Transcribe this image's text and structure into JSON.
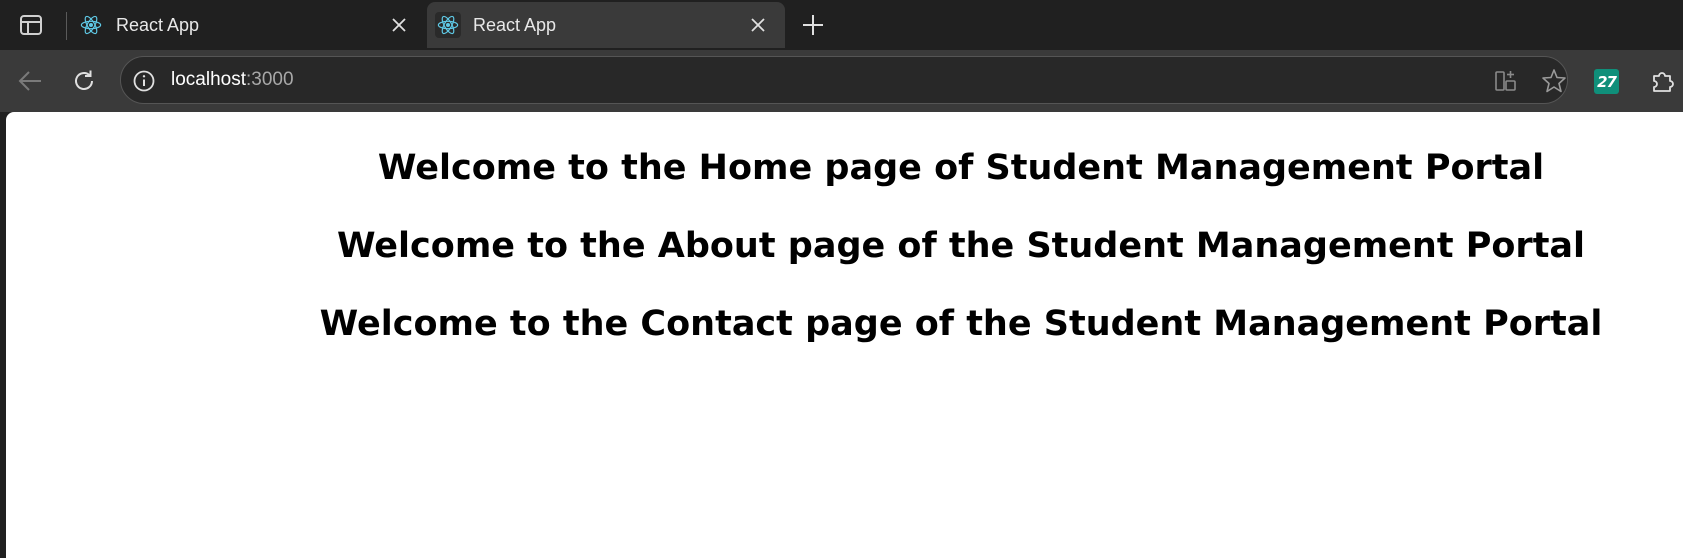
{
  "tabs": [
    {
      "title": "React App",
      "active": false
    },
    {
      "title": "React App",
      "active": true
    }
  ],
  "icons": {
    "tab_actions": "tab-actions-icon",
    "favicon": "react-icon",
    "close": "close-icon",
    "new_tab": "plus-icon",
    "back": "back-arrow-icon",
    "reload": "reload-icon",
    "site_info": "info-icon",
    "split_screen": "split-screen-icon",
    "favorite": "star-icon",
    "extensions": "puzzle-icon"
  },
  "address_bar": {
    "host": "localhost",
    "port": ":3000"
  },
  "extension_badge": {
    "label": "27",
    "color": "#0f8f7a"
  },
  "colors": {
    "react_logo": "#5fc9e6",
    "tab_strip": "#202020",
    "toolbar": "#3a3a3a",
    "page_background": "#ffffff"
  },
  "page": {
    "headings": [
      "Welcome to the Home page of Student Management Portal",
      "Welcome to the About page of the Student Management Portal",
      "Welcome to the Contact page of the Student Management Portal"
    ]
  }
}
